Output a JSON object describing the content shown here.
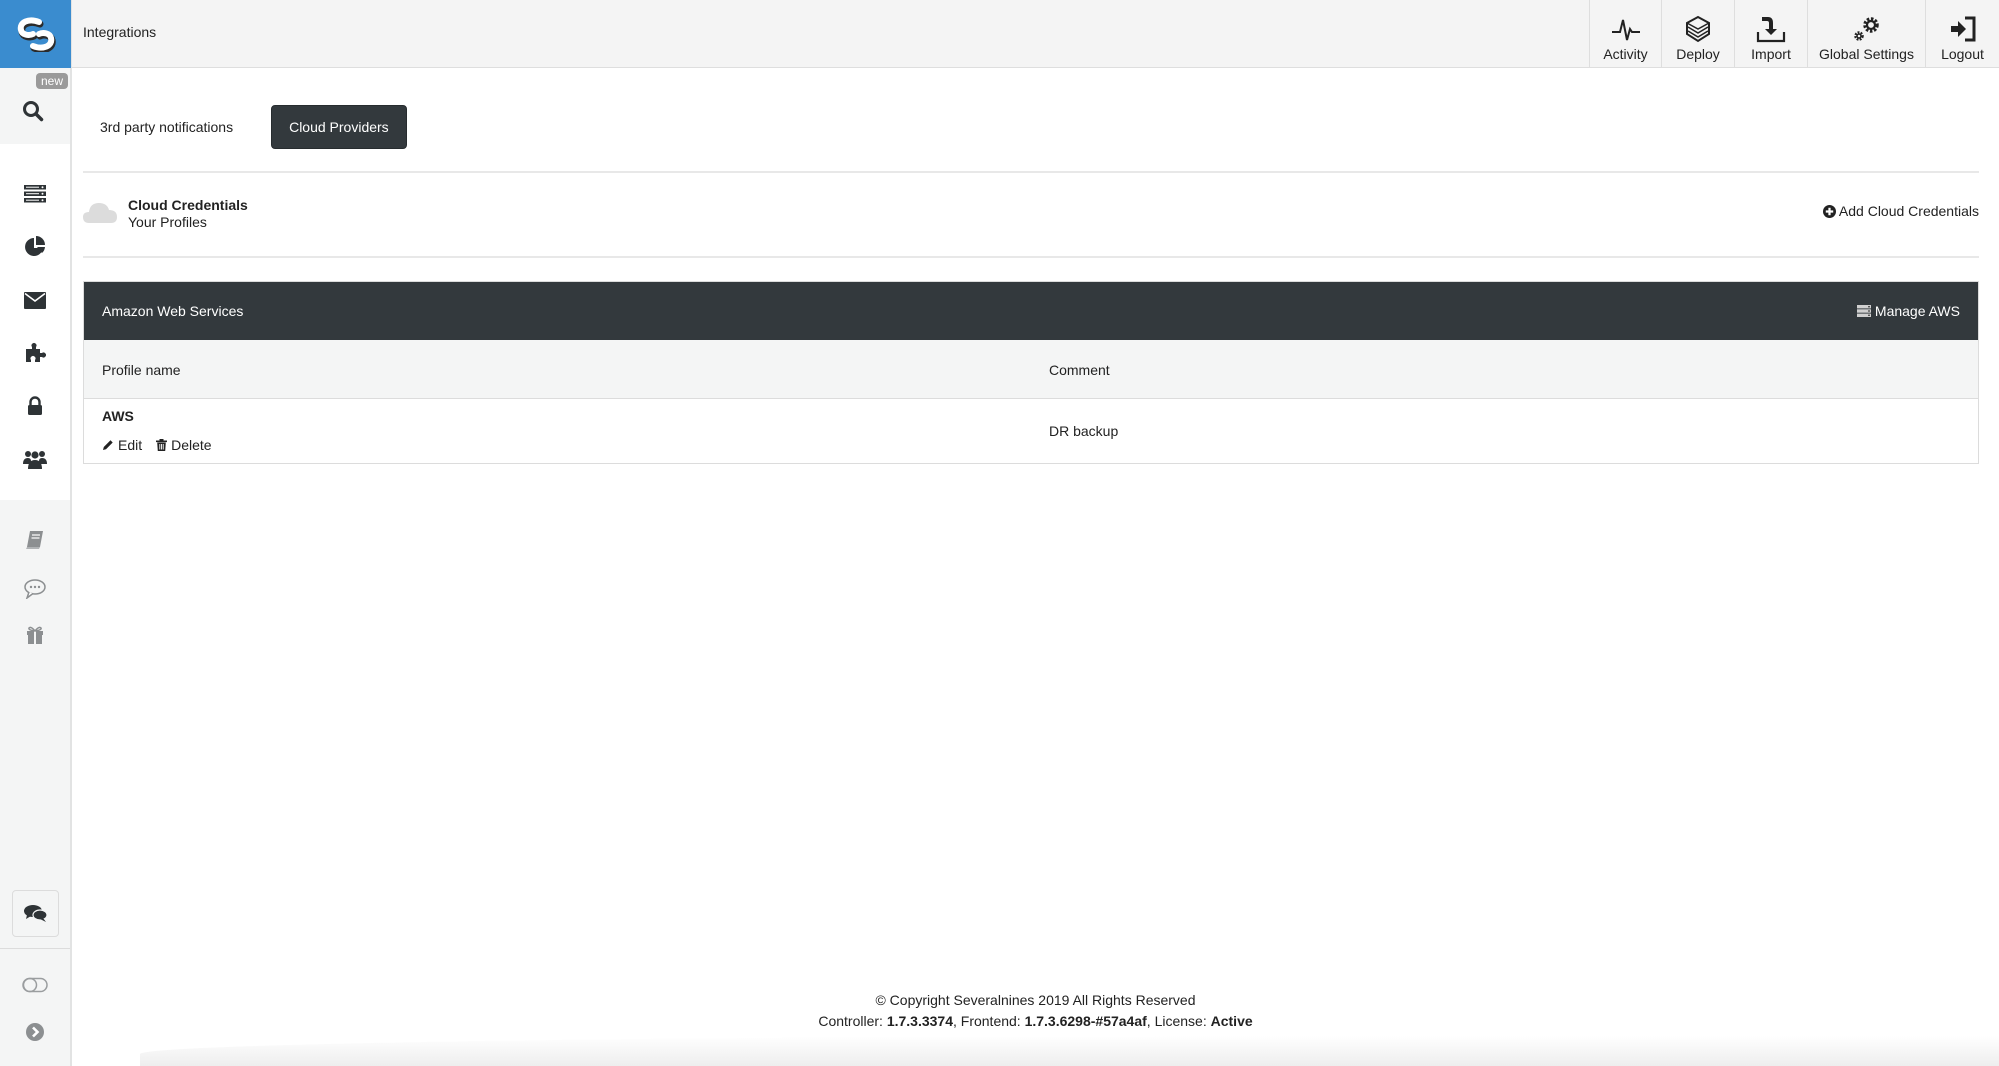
{
  "header": {
    "title": "Integrations",
    "nav": [
      {
        "label": "Activity",
        "icon": "activity-icon"
      },
      {
        "label": "Deploy",
        "icon": "layers-icon"
      },
      {
        "label": "Import",
        "icon": "import-icon"
      },
      {
        "label": "Global Settings",
        "icon": "gears-icon"
      },
      {
        "label": "Logout",
        "icon": "logout-icon"
      }
    ]
  },
  "sidebar": {
    "badge": "new",
    "items": [
      {
        "name": "search",
        "icon": "search-icon"
      },
      {
        "name": "clusters",
        "icon": "server-list-icon"
      },
      {
        "name": "reports",
        "icon": "pie-chart-icon"
      },
      {
        "name": "notifications",
        "icon": "envelope-icon"
      },
      {
        "name": "integrations",
        "icon": "puzzle-icon"
      },
      {
        "name": "security",
        "icon": "lock-icon"
      },
      {
        "name": "users",
        "icon": "users-icon"
      },
      {
        "name": "documentation",
        "icon": "book-icon"
      },
      {
        "name": "feedback",
        "icon": "speech-bubble-icon"
      },
      {
        "name": "whats-new",
        "icon": "gift-icon"
      },
      {
        "name": "chat",
        "icon": "comments-icon"
      },
      {
        "name": "theme-toggle",
        "icon": "toggle-icon"
      },
      {
        "name": "expand",
        "icon": "chevron-right-circle-icon"
      }
    ]
  },
  "tabs": [
    {
      "label": "3rd party notifications",
      "active": false
    },
    {
      "label": "Cloud Providers",
      "active": true
    }
  ],
  "credentials": {
    "title": "Cloud Credentials",
    "subtitle": "Your Profiles",
    "add_label": "Add Cloud Credentials"
  },
  "provider_panel": {
    "title": "Amazon Web Services",
    "manage_label": "Manage AWS",
    "columns": [
      "Profile name",
      "Comment"
    ],
    "rows": [
      {
        "profile": "AWS",
        "comment": "DR backup",
        "actions": [
          "Edit",
          "Delete"
        ]
      }
    ]
  },
  "footer": {
    "copyright": "© Copyright Severalnines 2019 All Rights Reserved",
    "controller_label": "Controller: ",
    "controller_version": "1.7.3.3374",
    "frontend_label": ", Frontend: ",
    "frontend_version": "1.7.3.6298-#57a4af",
    "license_label": ", License: ",
    "license_status": "Active"
  },
  "colors": {
    "brand": "#3a8ccf",
    "dark_panel": "#33393d",
    "sidebar_bg": "#f4f5f5"
  }
}
